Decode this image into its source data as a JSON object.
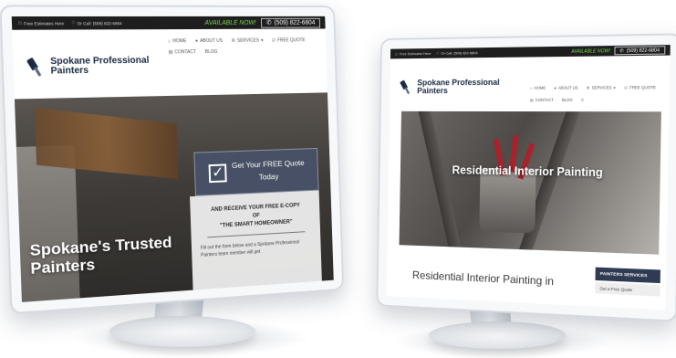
{
  "left_site": {
    "topbar": {
      "free_estimates": "Free Estimates Here",
      "or_call": "Or Call: (509) 822-6804",
      "available_now": "AVAILABLE NOW!",
      "phone": "(509) 822-6804"
    },
    "logo": {
      "line1": "Spokane Professional",
      "line2": "Painters"
    },
    "nav": {
      "home": "HOME",
      "about": "ABOUT US",
      "services": "SERVICES",
      "free_quote": "FREE QUOTE",
      "contact": "CONTACT",
      "blog": "BLOG"
    },
    "hero": {
      "title_line1": "Spokane's Trusted",
      "title_line2": "Painters",
      "quote_line1": "Get Your FREE Quote",
      "quote_line2": "Today",
      "panel_line1": "AND RECEIVE YOUR FREE E-COPY",
      "panel_line2": "OF",
      "panel_line3": "\"THE SMART HOMEOWNER\"",
      "panel_body": "Fill out the form below and a Spokane Professional Painters team member will get"
    }
  },
  "right_site": {
    "topbar": {
      "free_estimates": "Free Estimates Here",
      "or_call": "Or Call: (509) 822-6804",
      "available_now": "AVAILABLE NOW!",
      "phone": "(509) 822-6804"
    },
    "logo": {
      "line1": "Spokane Professional",
      "line2": "Painters"
    },
    "nav": {
      "home": "HOME",
      "about": "ABOUT US",
      "services": "SERVICES",
      "free_quote": "FREE QUOTE",
      "contact": "CONTACT",
      "blog": "BLOG"
    },
    "hero": {
      "title": "Residential Interior Painting"
    },
    "page_heading": "Residential Interior Painting in",
    "sidebar": {
      "heading": "PAINTERS SERVICES",
      "item1": "Get a Free Quote"
    }
  },
  "colors": {
    "topbar_bg": "#1e1e1e",
    "available_green": "#7bd94f",
    "logo_navy": "#1c2a44",
    "quote_box": "#475064",
    "sidebar_head": "#2f3b52"
  },
  "icons": [
    "search-icon",
    "home-icon",
    "user-icon",
    "gear-icon",
    "check-square-icon",
    "phone-icon",
    "document-icon",
    "paintbrush-logo-icon"
  ]
}
